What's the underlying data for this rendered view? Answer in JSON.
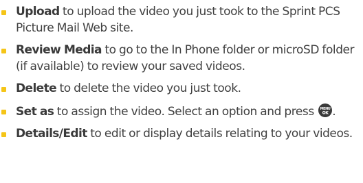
{
  "accent_color": "#f5c518",
  "items": [
    {
      "term": "Upload",
      "text": " to upload the video you just took to the Sprint PCS Picture Mail Web site."
    },
    {
      "term": "Review Media",
      "text": " to go to the In Phone folder or microSD folder (if available) to review your saved videos."
    },
    {
      "term": "Delete",
      "text": " to delete the video you just took."
    },
    {
      "term": "Set as",
      "text": " to assign the video. Select an option and press ",
      "icon": "menu-ok-key-icon",
      "text_after": "."
    },
    {
      "term": "Details/Edit",
      "text": " to edit or display details relating to your videos."
    }
  ]
}
